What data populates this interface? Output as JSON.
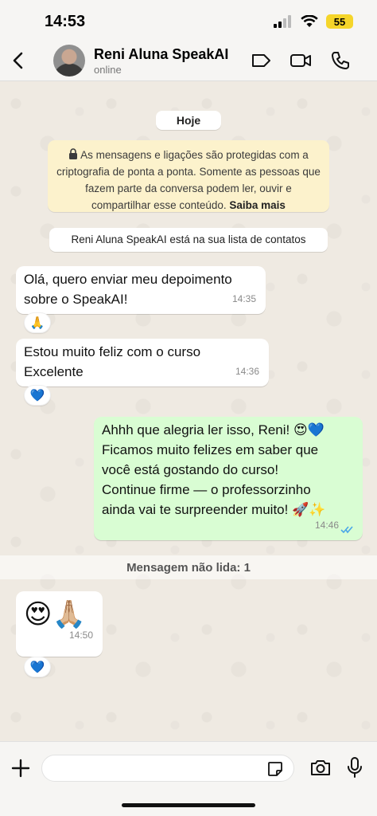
{
  "status_bar": {
    "time": "14:53",
    "battery": "55"
  },
  "header": {
    "contact_name": "Reni Aluna SpeakAI",
    "contact_status": "online"
  },
  "chat": {
    "date_label": "Hoje",
    "encryption_text": "As mensagens e ligações são protegidas com a criptografia de ponta a ponta. Somente as pessoas que fazem parte da conversa podem ler, ouvir e compartilhar esse conteúdo.",
    "encryption_link": "Saiba mais",
    "contact_notice": "Reni Aluna SpeakAI está na sua lista de contatos",
    "messages": [
      {
        "direction": "in",
        "line1": "Olá, quero enviar meu depoimento",
        "line2": "sobre o SpeakAI!",
        "time": "14:35",
        "reaction": "🙏"
      },
      {
        "direction": "in",
        "line1": "Estou muito feliz com o curso",
        "line2": "Excelente",
        "time": "14:36",
        "reaction": "💙"
      },
      {
        "direction": "out",
        "line1": "Ahhh que alegria ler isso, Reni! 😍💙",
        "line2": "Ficamos muito felizes em saber que",
        "line3": "você está gostando do curso!",
        "line4": "Continue firme — o professorzinho",
        "line5": "ainda vai te surpreender muito! 🚀✨",
        "time": "14:46"
      },
      {
        "direction": "in",
        "text": "😍🙏🏼",
        "time": "14:50",
        "reaction": "💙"
      }
    ],
    "unread_label": "Mensagem não lida: 1"
  },
  "icons": [
    "back-icon",
    "video-tag-icon",
    "video-call-icon",
    "phone-icon",
    "lock-icon",
    "plus-icon",
    "sticker-icon",
    "camera-icon",
    "mic-icon",
    "read-check-icon"
  ]
}
